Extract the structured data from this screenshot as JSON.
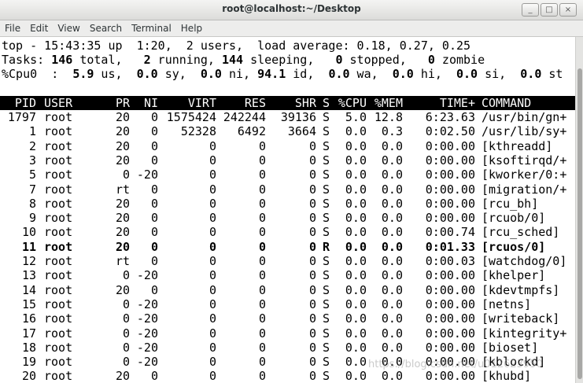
{
  "window": {
    "title": "root@localhost:~/Desktop",
    "buttons": [
      "_",
      "□",
      "×"
    ]
  },
  "menu": [
    "File",
    "Edit",
    "View",
    "Search",
    "Terminal",
    "Help"
  ],
  "top_summary": {
    "line1": "top - 15:43:35 up  1:20,  2 users,  load average: 0.18, 0.27, 0.25",
    "tasks": {
      "prefix": "Tasks: ",
      "total": "146",
      "total_label": " total,   ",
      "running": "2",
      "running_label": " running, ",
      "sleeping": "144",
      "sleeping_label": " sleeping,   ",
      "stopped": "0",
      "stopped_label": " stopped,   ",
      "zombie": "0",
      "zombie_label": " zombie"
    },
    "cpu": {
      "prefix": "%Cpu0  :  ",
      "us": "5.9",
      "us_label": " us,  ",
      "sy": "0.0",
      "sy_label": " sy,  ",
      "ni": "0.0",
      "ni_label": " ni, ",
      "id": "94.1",
      "id_label": " id,  ",
      "wa": "0.0",
      "wa_label": " wa,  ",
      "hi": "0.0",
      "hi_label": " hi,  ",
      "si": "0.0",
      "si_label": " si,  ",
      "st": "0.0",
      "st_label": " st"
    }
  },
  "columns": [
    "PID",
    "USER",
    "PR",
    "NI",
    "VIRT",
    "RES",
    "SHR",
    "S",
    "%CPU",
    "%MEM",
    "TIME+",
    "COMMAND"
  ],
  "processes": [
    {
      "pid": "1797",
      "user": "root",
      "pr": "20",
      "ni": "0",
      "virt": "1575424",
      "res": "242244",
      "shr": "39136",
      "s": "S",
      "cpu": "5.0",
      "mem": "12.8",
      "time": "6:23.63",
      "cmd": "/usr/bin/gn+"
    },
    {
      "pid": "1",
      "user": "root",
      "pr": "20",
      "ni": "0",
      "virt": "52328",
      "res": "6492",
      "shr": "3664",
      "s": "S",
      "cpu": "0.0",
      "mem": "0.3",
      "time": "0:02.50",
      "cmd": "/usr/lib/sy+"
    },
    {
      "pid": "2",
      "user": "root",
      "pr": "20",
      "ni": "0",
      "virt": "0",
      "res": "0",
      "shr": "0",
      "s": "S",
      "cpu": "0.0",
      "mem": "0.0",
      "time": "0:00.00",
      "cmd": "[kthreadd]"
    },
    {
      "pid": "3",
      "user": "root",
      "pr": "20",
      "ni": "0",
      "virt": "0",
      "res": "0",
      "shr": "0",
      "s": "S",
      "cpu": "0.0",
      "mem": "0.0",
      "time": "0:00.00",
      "cmd": "[ksoftirqd/+"
    },
    {
      "pid": "5",
      "user": "root",
      "pr": "0",
      "ni": "-20",
      "virt": "0",
      "res": "0",
      "shr": "0",
      "s": "S",
      "cpu": "0.0",
      "mem": "0.0",
      "time": "0:00.00",
      "cmd": "[kworker/0:+"
    },
    {
      "pid": "7",
      "user": "root",
      "pr": "rt",
      "ni": "0",
      "virt": "0",
      "res": "0",
      "shr": "0",
      "s": "S",
      "cpu": "0.0",
      "mem": "0.0",
      "time": "0:00.00",
      "cmd": "[migration/+"
    },
    {
      "pid": "8",
      "user": "root",
      "pr": "20",
      "ni": "0",
      "virt": "0",
      "res": "0",
      "shr": "0",
      "s": "S",
      "cpu": "0.0",
      "mem": "0.0",
      "time": "0:00.00",
      "cmd": "[rcu_bh]"
    },
    {
      "pid": "9",
      "user": "root",
      "pr": "20",
      "ni": "0",
      "virt": "0",
      "res": "0",
      "shr": "0",
      "s": "S",
      "cpu": "0.0",
      "mem": "0.0",
      "time": "0:00.00",
      "cmd": "[rcuob/0]"
    },
    {
      "pid": "10",
      "user": "root",
      "pr": "20",
      "ni": "0",
      "virt": "0",
      "res": "0",
      "shr": "0",
      "s": "S",
      "cpu": "0.0",
      "mem": "0.0",
      "time": "0:00.74",
      "cmd": "[rcu_sched]"
    },
    {
      "pid": "11",
      "user": "root",
      "pr": "20",
      "ni": "0",
      "virt": "0",
      "res": "0",
      "shr": "0",
      "s": "R",
      "cpu": "0.0",
      "mem": "0.0",
      "time": "0:01.33",
      "cmd": "[rcuos/0]",
      "bold": true
    },
    {
      "pid": "12",
      "user": "root",
      "pr": "rt",
      "ni": "0",
      "virt": "0",
      "res": "0",
      "shr": "0",
      "s": "S",
      "cpu": "0.0",
      "mem": "0.0",
      "time": "0:00.03",
      "cmd": "[watchdog/0]"
    },
    {
      "pid": "13",
      "user": "root",
      "pr": "0",
      "ni": "-20",
      "virt": "0",
      "res": "0",
      "shr": "0",
      "s": "S",
      "cpu": "0.0",
      "mem": "0.0",
      "time": "0:00.00",
      "cmd": "[khelper]"
    },
    {
      "pid": "14",
      "user": "root",
      "pr": "20",
      "ni": "0",
      "virt": "0",
      "res": "0",
      "shr": "0",
      "s": "S",
      "cpu": "0.0",
      "mem": "0.0",
      "time": "0:00.00",
      "cmd": "[kdevtmpfs]"
    },
    {
      "pid": "15",
      "user": "root",
      "pr": "0",
      "ni": "-20",
      "virt": "0",
      "res": "0",
      "shr": "0",
      "s": "S",
      "cpu": "0.0",
      "mem": "0.0",
      "time": "0:00.00",
      "cmd": "[netns]"
    },
    {
      "pid": "16",
      "user": "root",
      "pr": "0",
      "ni": "-20",
      "virt": "0",
      "res": "0",
      "shr": "0",
      "s": "S",
      "cpu": "0.0",
      "mem": "0.0",
      "time": "0:00.00",
      "cmd": "[writeback]"
    },
    {
      "pid": "17",
      "user": "root",
      "pr": "0",
      "ni": "-20",
      "virt": "0",
      "res": "0",
      "shr": "0",
      "s": "S",
      "cpu": "0.0",
      "mem": "0.0",
      "time": "0:00.00",
      "cmd": "[kintegrity+"
    },
    {
      "pid": "18",
      "user": "root",
      "pr": "0",
      "ni": "-20",
      "virt": "0",
      "res": "0",
      "shr": "0",
      "s": "S",
      "cpu": "0.0",
      "mem": "0.0",
      "time": "0:00.00",
      "cmd": "[bioset]"
    },
    {
      "pid": "19",
      "user": "root",
      "pr": "0",
      "ni": "-20",
      "virt": "0",
      "res": "0",
      "shr": "0",
      "s": "S",
      "cpu": "0.0",
      "mem": "0.0",
      "time": "0:00.00",
      "cmd": "[kblockd]"
    },
    {
      "pid": "20",
      "user": "root",
      "pr": "20",
      "ni": "0",
      "virt": "0",
      "res": "0",
      "shr": "0",
      "s": "S",
      "cpu": "0.0",
      "mem": "0.0",
      "time": "0:00.00",
      "cmd": "[khubd]"
    }
  ],
  "watermark": "https://blog.csdn.net/u012623950"
}
